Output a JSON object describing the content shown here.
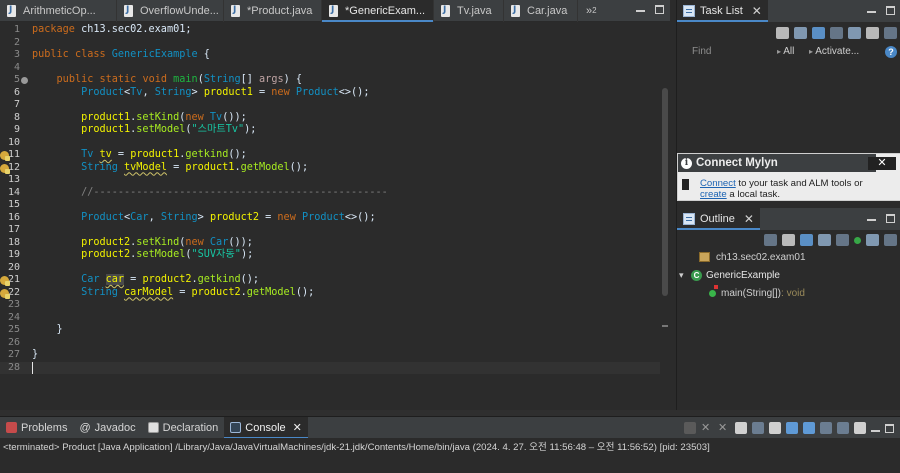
{
  "editor_tabs": [
    {
      "label": "ArithmeticOp...",
      "active": false
    },
    {
      "label": "OverflowUnde...",
      "active": false
    },
    {
      "label": "*Product.java",
      "active": false
    },
    {
      "label": "*GenericExam...",
      "active": true
    },
    {
      "label": "Tv.java",
      "active": false
    },
    {
      "label": "Car.java",
      "active": false
    }
  ],
  "tab_overflow": "»",
  "tab_overflow_count": "2",
  "code_lines": [
    {
      "n": "1",
      "html": "<span class='kw'>package</span> ch13.sec02.exam01;"
    },
    {
      "n": "2",
      "html": ""
    },
    {
      "n": "3",
      "html": "<span class='kw'>public</span> <span class='kw'>class</span> <span class='ty'>GenericExample</span> {"
    },
    {
      "n": "4",
      "html": ""
    },
    {
      "n": "5",
      "html": "    <span class='kw'>public</span> <span class='kw'>static</span> <span class='kw'>void</span> <span class='fn'>main</span>(<span class='ty'>String</span>[] <span class='tp'>args</span>) {"
    },
    {
      "n": "6",
      "html": "        <span class='ty'>Product</span>&lt;<span class='ty'>Tv</span>, <span class='ty'>String</span>&gt; <span class='lv'>product1</span> = <span class='kw'>new</span> <span class='ty'>Product</span>&lt;&gt;();"
    },
    {
      "n": "7",
      "html": ""
    },
    {
      "n": "8",
      "html": "        <span class='lv'>product1</span>.<span class='mt'>setKind</span>(<span class='kw'>new</span> <span class='ty'>Tv</span>());"
    },
    {
      "n": "9",
      "html": "        <span class='lv'>product1</span>.<span class='mt'>setModel</span>(<span class='st'>\"스마트Tv\"</span>);"
    },
    {
      "n": "10",
      "html": ""
    },
    {
      "n": "11",
      "html": "        <span class='ty'>Tv</span> <span class='lv wv'>tv</span> = <span class='lv'>product1</span>.<span class='mt'>getkind</span>();"
    },
    {
      "n": "12",
      "html": "        <span class='ty'>String</span> <span class='lv wv'>tvModel</span> = <span class='lv'>product1</span>.<span class='mt'>getModel</span>();"
    },
    {
      "n": "13",
      "html": ""
    },
    {
      "n": "14",
      "html": "        <span class='cm'>//------------------------------------------------</span>"
    },
    {
      "n": "15",
      "html": ""
    },
    {
      "n": "16",
      "html": "        <span class='ty'>Product</span>&lt;<span class='ty'>Car</span>, <span class='ty'>String</span>&gt; <span class='lv'>product2</span> = <span class='kw'>new</span> <span class='ty'>Product</span>&lt;&gt;();"
    },
    {
      "n": "17",
      "html": ""
    },
    {
      "n": "18",
      "html": "        <span class='lv'>product2</span>.<span class='mt'>setKind</span>(<span class='kw'>new</span> <span class='ty'>Car</span>());"
    },
    {
      "n": "19",
      "html": "        <span class='lv'>product2</span>.<span class='mt'>setModel</span>(<span class='st'>\"SUV자동\"</span>);"
    },
    {
      "n": "20",
      "html": ""
    },
    {
      "n": "21",
      "html": "        <span class='ty'>Car</span> <span class='lv wv occ'>car</span> = <span class='lv'>product2</span>.<span class='mt'>getkind</span>();"
    },
    {
      "n": "22",
      "html": "        <span class='ty'>String</span> <span class='lv wv'>carModel</span> = <span class='lv'>product2</span>.<span class='mt'>getModel</span>();"
    },
    {
      "n": "23",
      "html": ""
    },
    {
      "n": "24",
      "html": ""
    },
    {
      "n": "25",
      "html": "    }"
    },
    {
      "n": "26",
      "html": ""
    },
    {
      "n": "27",
      "html": "}"
    },
    {
      "n": "28",
      "html": ""
    }
  ],
  "task_list": {
    "title": "Task List",
    "find_placeholder": "Find",
    "all_label": "All",
    "activate_label": "Activate...",
    "help_glyph": "?"
  },
  "mylyn": {
    "title": "Connect Mylyn",
    "close": "✕",
    "connect_link": "Connect",
    "text1": " to your task and ALM tools or",
    "create_link": "create",
    "text2": " a local task.",
    "info_glyph": "i"
  },
  "outline": {
    "title": "Outline",
    "package": "ch13.sec02.exam01",
    "class_name": "GenericExample",
    "class_glyph": "C",
    "method_name": "main(String[])",
    "method_return": " : void"
  },
  "console": {
    "tabs": [
      {
        "label": "Problems",
        "glyph": ""
      },
      {
        "label": "Javadoc",
        "glyph": "@"
      },
      {
        "label": "Declaration",
        "glyph": ""
      },
      {
        "label": "Console",
        "glyph": ""
      }
    ],
    "status": "<terminated> Product [Java Application] /Library/Java/JavaVirtualMachines/jdk-21.jdk/Contents/Home/bin/java  (2024. 4. 27. 오전 11:56:48 – 오전 11:56:52) [pid: 23503]"
  },
  "glyphs": {
    "close": "✕",
    "twisty_open": "▾"
  }
}
